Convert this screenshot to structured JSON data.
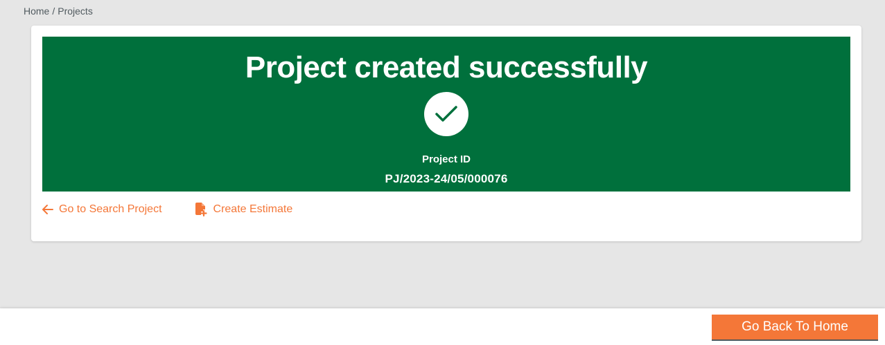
{
  "breadcrumb": {
    "items": [
      "Home",
      "Projects"
    ],
    "separator": "/"
  },
  "banner": {
    "title": "Project created successfully",
    "icon": "check-icon",
    "id_label": "Project ID",
    "id_value": "PJ/2023-24/05/000076",
    "background_color": "#00703c"
  },
  "links": {
    "search": {
      "label": "Go to Search Project",
      "icon": "arrow-left-icon"
    },
    "estimate": {
      "label": "Create Estimate",
      "icon": "file-add-icon"
    }
  },
  "footer": {
    "home_button": "Go Back To Home"
  },
  "colors": {
    "accent": "#f47738",
    "success": "#00703c",
    "background": "#e6e6e6"
  }
}
